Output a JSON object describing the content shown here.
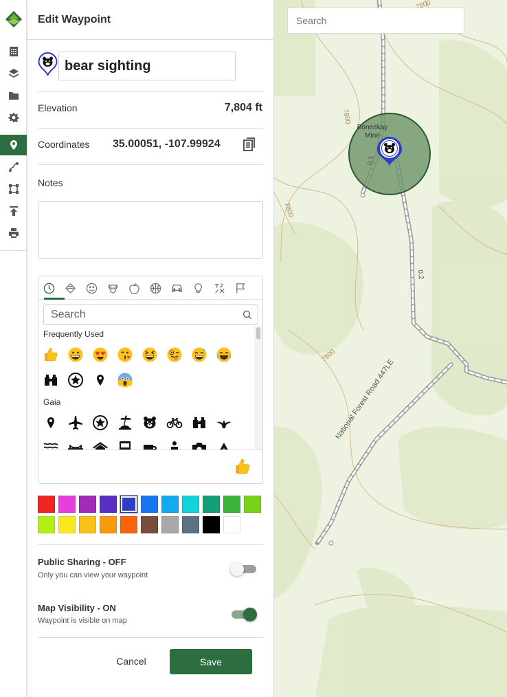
{
  "app": {
    "logo": "gaia-logo-icon"
  },
  "rail": {
    "items": [
      {
        "name": "calendar-grid-icon"
      },
      {
        "name": "layers-icon"
      },
      {
        "name": "folder-icon"
      },
      {
        "name": "gear-icon"
      },
      {
        "name": "waypoint-pin-icon",
        "active": true
      },
      {
        "name": "route-icon"
      },
      {
        "name": "area-icon"
      },
      {
        "name": "upload-icon"
      },
      {
        "name": "print-icon"
      }
    ]
  },
  "panel": {
    "title": "Edit Waypoint",
    "name_value": "bear sighting",
    "waypoint_icon": "bear-icon",
    "elevation": {
      "label": "Elevation",
      "value": "7,804 ft"
    },
    "coordinates": {
      "label": "Coordinates",
      "value": "35.00051, -107.99924"
    },
    "notes": {
      "label": "Notes",
      "value": ""
    }
  },
  "picker": {
    "search_placeholder": "Search",
    "sections": [
      {
        "title": "Frequently Used"
      },
      {
        "title": "Gaia"
      }
    ],
    "categories": [
      "recent-icon",
      "gaia-icon",
      "smiley-icon",
      "animal-icon",
      "food-icon",
      "activity-icon",
      "travel-icon",
      "objects-icon",
      "symbols-icon",
      "flags-icon"
    ],
    "frequently_used": [
      "thumbs-up",
      "grinning",
      "heart-eyes",
      "kissing-wink",
      "laughing",
      "winking-tongue",
      "sweat-smile",
      "tears-of-joy",
      "binoculars",
      "star-circle",
      "pin",
      "scream"
    ],
    "gaia": [
      "pin",
      "airplane",
      "star-circle",
      "palm-island",
      "bear",
      "bicycle",
      "binoculars",
      "bird",
      "waves",
      "bridge",
      "house",
      "bus",
      "mug",
      "person",
      "camera",
      "tent"
    ],
    "preview": "thumbs-up"
  },
  "colors": {
    "row1": [
      "#f0251f",
      "#e83fdc",
      "#a12bb8",
      "#5a2ec2",
      "#2f3cc7",
      "#1976f0",
      "#13a9f0",
      "#12d3d8",
      "#139f77",
      "#3bb53a",
      "#78d317"
    ],
    "row2": [
      "#b4ee14",
      "#fbe81c",
      "#f7c215",
      "#f7990d",
      "#f9630c",
      "#794c3b",
      "#a8a8a8",
      "#5e7282",
      "#000000",
      "#ffffff"
    ],
    "selected": "#2f3cc7"
  },
  "sharing": {
    "title": "Public Sharing - OFF",
    "subtitle": "Only you can view your waypoint",
    "on": false
  },
  "visibility": {
    "title": "Map Visibility - ON",
    "subtitle": "Waypoint is visible on map",
    "on": true
  },
  "actions": {
    "cancel": "Cancel",
    "save": "Save"
  },
  "map": {
    "search_placeholder": "Search",
    "mine_label": "Boneekay Mine",
    "road_label": "National Forest Road 447LE",
    "contour_labels": [
      "7800",
      "7800",
      "7800",
      "7800"
    ],
    "distance_labels": [
      "0.1",
      "0.2"
    ]
  },
  "accent": "#2c6e3f"
}
